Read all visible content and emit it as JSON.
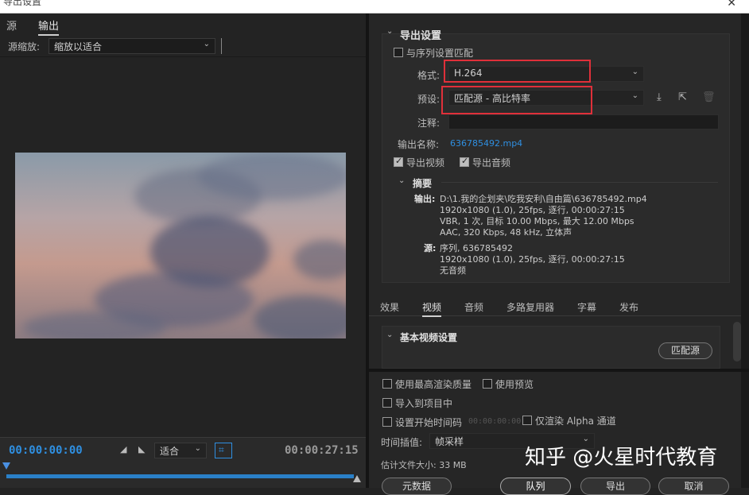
{
  "window": {
    "title": "导出设置",
    "close_glyph": "✕"
  },
  "left": {
    "tabs": [
      {
        "label": "源"
      },
      {
        "label": "输出"
      }
    ],
    "source_zoom": {
      "label": "源缩放:",
      "value": "缩放以适合"
    },
    "timeline": {
      "start": "00:00:00:00",
      "end": "00:00:27:15",
      "fit": "适合"
    }
  },
  "export": {
    "section_title": "导出设置",
    "match_sequence": {
      "label": "与序列设置匹配",
      "checked": false
    },
    "format": {
      "label": "格式:",
      "value": "H.264"
    },
    "preset": {
      "label": "预设:",
      "value": "匹配源 - 高比特率"
    },
    "comments": {
      "label": "注释:",
      "value": ""
    },
    "output_name": {
      "label": "输出名称:",
      "value": "636785492.mp4"
    },
    "export_video": {
      "label": "导出视频",
      "checked": true
    },
    "export_audio": {
      "label": "导出音频",
      "checked": true
    },
    "summary": {
      "title": "摘要",
      "output_label": "输出:",
      "output_lines": [
        "D:\\1.我的企划夹\\吃我安利\\自由篇\\636785492.mp4",
        "1920x1080 (1.0), 25fps, 逐行, 00:00:27:15",
        "VBR, 1 次, 目标 10.00 Mbps, 最大 12.00 Mbps",
        "AAC, 320 Kbps, 48 kHz, 立体声"
      ],
      "source_label": "源:",
      "source_lines": [
        "序列, 636785492",
        "1920x1080 (1.0), 25fps, 逐行, 00:00:27:15",
        "无音频"
      ]
    }
  },
  "tabs_right": [
    {
      "label": "效果"
    },
    {
      "label": "视频"
    },
    {
      "label": "音频"
    },
    {
      "label": "多路复用器"
    },
    {
      "label": "字幕"
    },
    {
      "label": "发布"
    }
  ],
  "basic_video": {
    "title": "基本视频设置",
    "match_source": "匹配源"
  },
  "bottom": {
    "max_render": "使用最高渲染质量",
    "use_preview": "使用预览",
    "import_project": "导入到项目中",
    "set_start_tc": "设置开始时间码",
    "start_tc_value": "00:00:00:00",
    "render_alpha": "仅渲染 Alpha 通道",
    "time_interp_label": "时间插值:",
    "time_interp_value": "帧采样",
    "est_size": "估计文件大小: 33 MB",
    "buttons": {
      "metadata": "元数据",
      "queue": "队列",
      "export": "导出",
      "cancel": "取消"
    }
  },
  "watermark": "知乎 @火星时代教育"
}
